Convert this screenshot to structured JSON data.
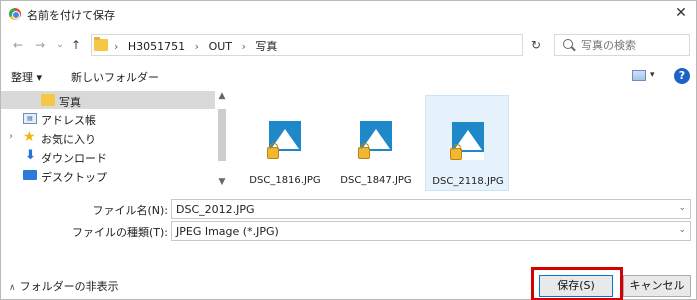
{
  "window": {
    "title": "名前を付けて保存",
    "close_glyph": "✕"
  },
  "nav_buttons": {
    "back": "←",
    "forward": "→",
    "recent": "⌄",
    "up": "↑"
  },
  "address": {
    "crumbs": [
      "H3051751",
      "OUT",
      "写真"
    ],
    "separator": "›",
    "dropdown_glyph": "⌄",
    "refresh_glyph": "↻"
  },
  "search": {
    "placeholder": "写真の検索"
  },
  "toolbar": {
    "organize_label": "整理 ▾",
    "new_folder_label": "新しいフォルダー",
    "view_dd_glyph": "▾",
    "help_glyph": "?"
  },
  "navpane": {
    "items": [
      {
        "label": "写真",
        "icon": "folder-icon",
        "selected": true
      },
      {
        "label": "アドレス帳",
        "icon": "contacts-icon"
      },
      {
        "label": "お気に入り",
        "icon": "star-icon",
        "expandable": true
      },
      {
        "label": "ダウンロード",
        "icon": "download-icon"
      },
      {
        "label": "デスクトップ",
        "icon": "desktop-icon"
      }
    ],
    "chevron_glyph": "›",
    "scroll_up_glyph": "▲",
    "scroll_down_glyph": "▼"
  },
  "files": [
    {
      "name": "DSC_1816.JPG",
      "selected": false
    },
    {
      "name": "DSC_1847.JPG",
      "selected": false
    },
    {
      "name": "DSC_2118.JPG",
      "selected": true
    }
  ],
  "form": {
    "filename_label": "ファイル名(N):",
    "filename_value": "DSC_2012.JPG",
    "filetype_label": "ファイルの種類(T):",
    "filetype_value": "JPEG Image (*.JPG)",
    "dropdown_glyph": "⌄"
  },
  "footer": {
    "hide_folders_label": "フォルダーの非表示",
    "hide_folders_glyph": "∧",
    "save_label": "保存(S)",
    "cancel_label": "キャンセル"
  },
  "colors": {
    "highlight": "#d50000",
    "selected_tile": "#e5f1fb",
    "nav_selected": "#d9d9d9",
    "help_blue": "#1b63c6",
    "folder_yellow": "#f6c646"
  }
}
